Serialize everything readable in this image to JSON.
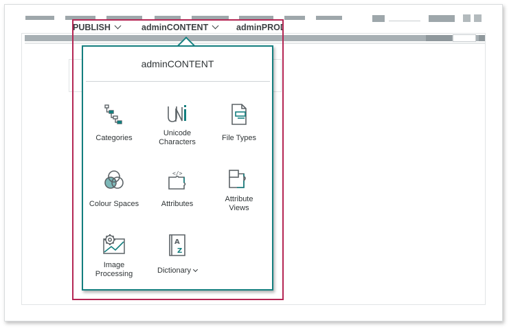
{
  "colors": {
    "accent_teal": "#137e7e",
    "highlight_crimson": "#b42553",
    "icon_gray": "#5b6266"
  },
  "nav": {
    "items": [
      {
        "label": "PUBLISH"
      },
      {
        "label": "adminCONTENT"
      },
      {
        "label": "adminPROD"
      }
    ]
  },
  "dropdown": {
    "title": "adminCONTENT",
    "tiles": [
      {
        "label": "Categories",
        "icon": "categories-icon"
      },
      {
        "label": "Unicode\nCharacters",
        "icon": "unicode-icon"
      },
      {
        "label": "File Types",
        "icon": "file-types-icon"
      },
      {
        "label": "Colour Spaces",
        "icon": "colour-spaces-icon"
      },
      {
        "label": "Attributes",
        "icon": "attributes-icon"
      },
      {
        "label": "Attribute\nViews",
        "icon": "attribute-views-icon"
      },
      {
        "label": "Image\nProcessing",
        "icon": "image-processing-icon"
      },
      {
        "label": "Dictionary",
        "icon": "dictionary-icon"
      }
    ]
  }
}
